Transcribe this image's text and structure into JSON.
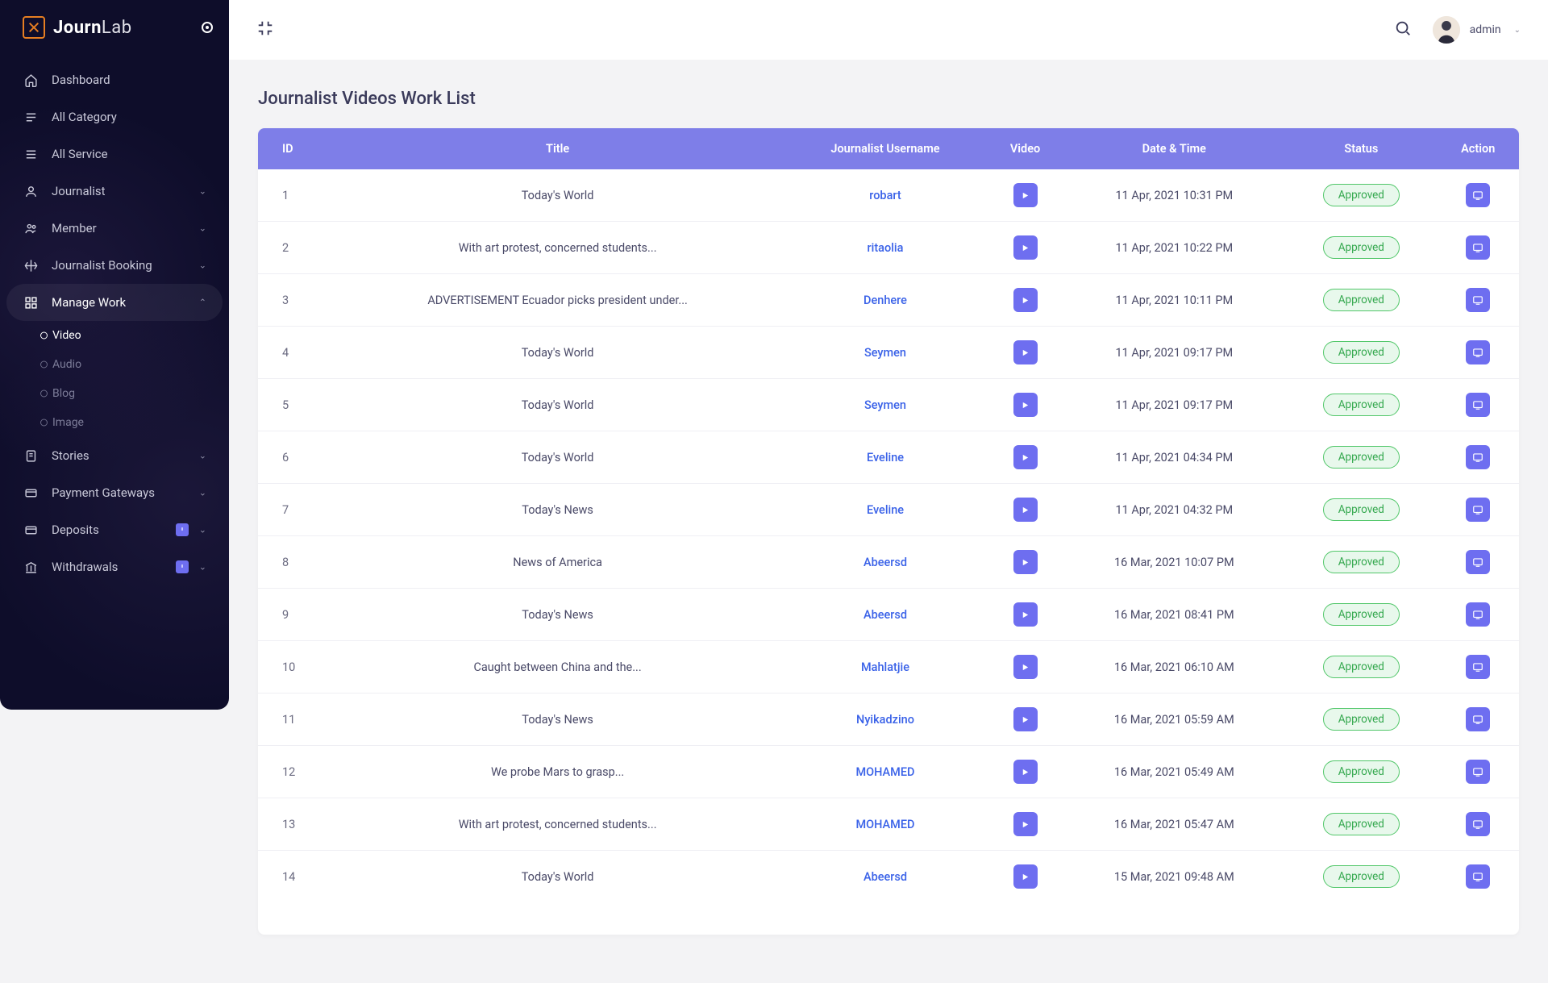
{
  "brand": {
    "name1": "Journ",
    "name2": "Lab"
  },
  "header": {
    "user": "admin"
  },
  "nav": {
    "dashboard": "Dashboard",
    "all_category": "All Category",
    "all_service": "All Service",
    "journalist": "Journalist",
    "member": "Member",
    "journalist_booking": "Journalist Booking",
    "manage_work": "Manage Work",
    "stories": "Stories",
    "payment_gateways": "Payment Gateways",
    "deposits": "Deposits",
    "withdrawals": "Withdrawals",
    "sub": {
      "video": "Video",
      "audio": "Audio",
      "blog": "Blog",
      "image": "Image"
    }
  },
  "page": {
    "title": "Journalist Videos Work List"
  },
  "table": {
    "headers": [
      "ID",
      "Title",
      "Journalist Username",
      "Video",
      "Date & Time",
      "Status",
      "Action"
    ],
    "rows": [
      {
        "id": "1",
        "title": "Today's World",
        "username": "robart",
        "datetime": "11 Apr, 2021 10:31 PM",
        "status": "Approved"
      },
      {
        "id": "2",
        "title": "With art protest, concerned students...",
        "username": "ritaolia",
        "datetime": "11 Apr, 2021 10:22 PM",
        "status": "Approved"
      },
      {
        "id": "3",
        "title": "ADVERTISEMENT Ecuador picks president under...",
        "username": "Denhere",
        "datetime": "11 Apr, 2021 10:11 PM",
        "status": "Approved"
      },
      {
        "id": "4",
        "title": "Today's World",
        "username": "Seymen",
        "datetime": "11 Apr, 2021 09:17 PM",
        "status": "Approved"
      },
      {
        "id": "5",
        "title": "Today's World",
        "username": "Seymen",
        "datetime": "11 Apr, 2021 09:17 PM",
        "status": "Approved"
      },
      {
        "id": "6",
        "title": "Today's World",
        "username": "Eveline",
        "datetime": "11 Apr, 2021 04:34 PM",
        "status": "Approved"
      },
      {
        "id": "7",
        "title": "Today's News",
        "username": "Eveline",
        "datetime": "11 Apr, 2021 04:32 PM",
        "status": "Approved"
      },
      {
        "id": "8",
        "title": "News of America",
        "username": "Abeersd",
        "datetime": "16 Mar, 2021 10:07 PM",
        "status": "Approved"
      },
      {
        "id": "9",
        "title": "Today's News",
        "username": "Abeersd",
        "datetime": "16 Mar, 2021 08:41 PM",
        "status": "Approved"
      },
      {
        "id": "10",
        "title": "Caught between China and the...",
        "username": "Mahlatjie",
        "datetime": "16 Mar, 2021 06:10 AM",
        "status": "Approved"
      },
      {
        "id": "11",
        "title": "Today's News",
        "username": "Nyikadzino",
        "datetime": "16 Mar, 2021 05:59 AM",
        "status": "Approved"
      },
      {
        "id": "12",
        "title": "We probe Mars to grasp...",
        "username": "MOHAMED",
        "datetime": "16 Mar, 2021 05:49 AM",
        "status": "Approved"
      },
      {
        "id": "13",
        "title": "With art protest, concerned students...",
        "username": "MOHAMED",
        "datetime": "16 Mar, 2021 05:47 AM",
        "status": "Approved"
      },
      {
        "id": "14",
        "title": "Today's World",
        "username": "Abeersd",
        "datetime": "15 Mar, 2021 09:48 AM",
        "status": "Approved"
      }
    ]
  }
}
